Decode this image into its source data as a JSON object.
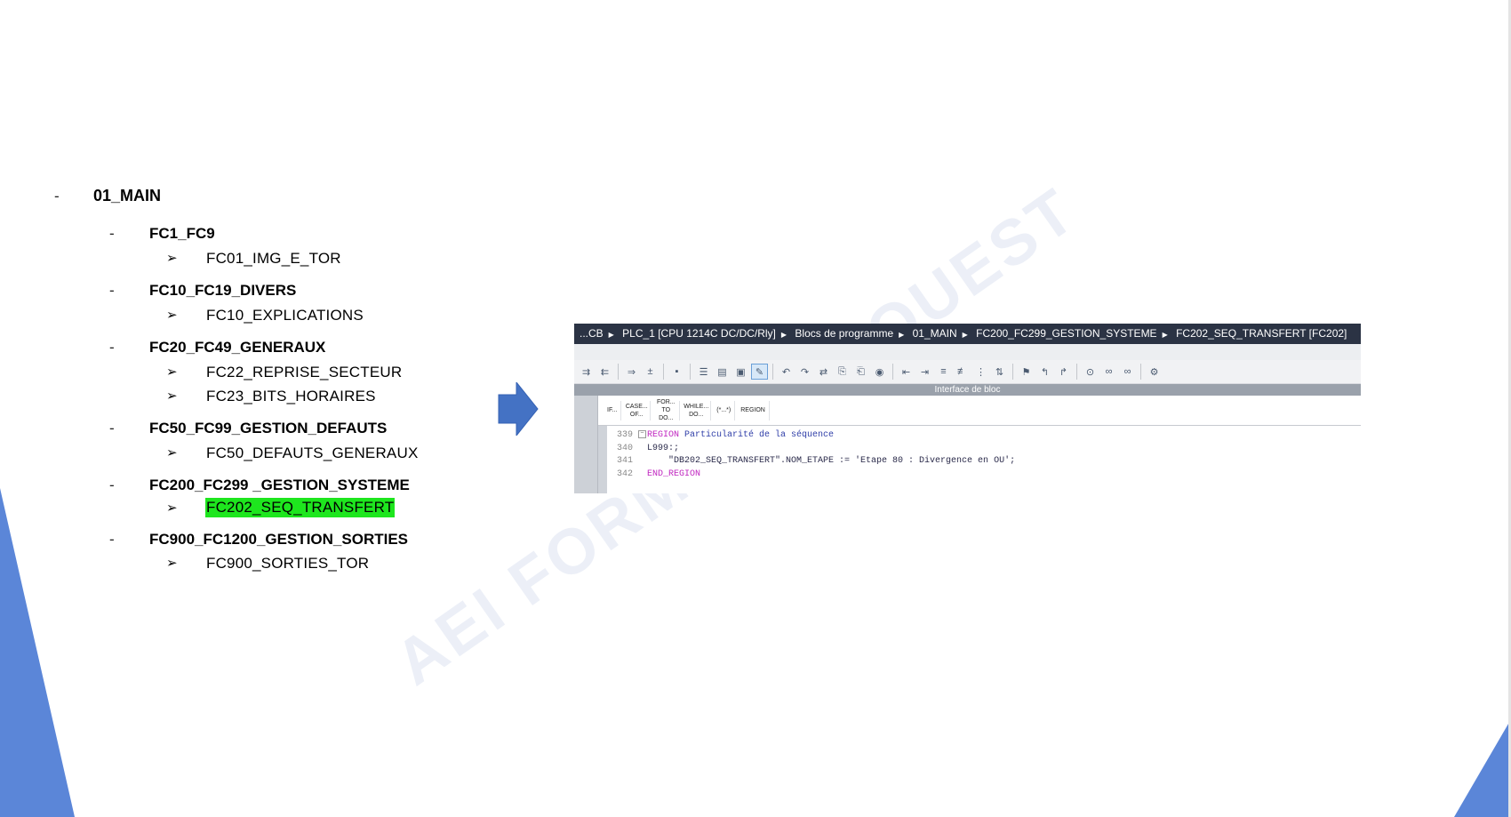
{
  "tree": {
    "root": {
      "dash": "-",
      "label": "01_MAIN"
    },
    "groups": [
      {
        "dash": "-",
        "label": "FC1_FC9",
        "items": [
          {
            "bullet": "➢",
            "label": "FC01_IMG_E_TOR"
          }
        ]
      },
      {
        "dash": "-",
        "label": "FC10_FC19_DIVERS",
        "items": [
          {
            "bullet": "➢",
            "label": "FC10_EXPLICATIONS"
          }
        ]
      },
      {
        "dash": "-",
        "label": "FC20_FC49_GENERAUX",
        "items": [
          {
            "bullet": "➢",
            "label": "FC22_REPRISE_SECTEUR"
          },
          {
            "bullet": "➢",
            "label": "FC23_BITS_HORAIRES"
          }
        ]
      },
      {
        "dash": "-",
        "label": "FC50_FC99_GESTION_DEFAUTS",
        "items": [
          {
            "bullet": "➢",
            "label": "FC50_DEFAUTS_GENERAUX"
          }
        ]
      },
      {
        "dash": "-",
        "label": "FC200_FC299 _GESTION_SYSTEME",
        "items": [
          {
            "bullet": "➢",
            "label": "FC202_SEQ_TRANSFERT",
            "highlighted": true
          }
        ]
      },
      {
        "dash": "-",
        "label": "FC900_FC1200_GESTION_SORTIES",
        "items": [
          {
            "bullet": "➢",
            "label": "FC900_SORTIES_TOR"
          }
        ]
      }
    ],
    "highlight_color": "#1ee61e"
  },
  "watermark": "AEI FORMATION OUEST",
  "tia": {
    "breadcrumb": [
      "...CB",
      "PLC_1 [CPU 1214C DC/DC/Rly]",
      "Blocs de programme",
      "01_MAIN",
      "FC200_FC299_GESTION_SYSTEME",
      "FC202_SEQ_TRANSFERT [FC202]"
    ],
    "breadcrumb_sep": "▶",
    "interface_label": "Interface de bloc",
    "keywords": [
      "IF...",
      "CASE... OF...",
      "FOR... TO DO...",
      "WHILE... DO...",
      "(*...*)",
      "REGION"
    ],
    "code": [
      {
        "line": "339",
        "keyword": "REGION",
        "text": " Particularité de la séquence"
      },
      {
        "line": "340",
        "keyword": "",
        "text": "L999:;"
      },
      {
        "line": "341",
        "keyword": "",
        "text": "    \"DB202_SEQ_TRANSFERT\".NOM_ETAPE := 'Etape 80 : Divergence en OU';"
      },
      {
        "line": "342",
        "keyword": "END_REGION",
        "text": ""
      }
    ]
  },
  "colors": {
    "triangle": "#5b86d8",
    "arrow": "#4472c4",
    "titlebar": "#2b3344"
  }
}
